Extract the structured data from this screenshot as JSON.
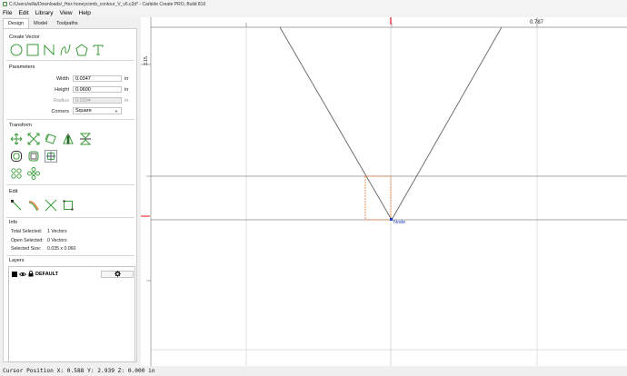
{
  "window": {
    "title": "C:/Users/willa/Downloads/_Hex honeycomb_contour_V_v6.c2d* - Carbide Create PRO, Build 816"
  },
  "menu": [
    "File",
    "Edit",
    "Library",
    "View",
    "Help"
  ],
  "tabs": [
    "Design",
    "Model",
    "Toolpaths"
  ],
  "create_vector": {
    "title": "Create Vector",
    "tools": [
      "circle-icon",
      "rectangle-icon",
      "polyline-icon",
      "curve-icon",
      "polygon-icon",
      "text-icon"
    ]
  },
  "parameters": {
    "title": "Parameters",
    "width": {
      "label": "Width",
      "value": "0.0347",
      "unit": "in"
    },
    "height": {
      "label": "Height",
      "value": "0.0600",
      "unit": "in"
    },
    "radius": {
      "label": "Radius",
      "value": "0.0394",
      "unit": "in"
    },
    "corners": {
      "label": "Corners",
      "value": "Square"
    }
  },
  "transform": {
    "title": "Transform"
  },
  "edit": {
    "title": "Edit"
  },
  "info": {
    "title": "Info",
    "total_selected_label": "Total Selected:",
    "total_selected_value": "1 Vectors",
    "open_selected_label": "Open Selected:",
    "open_selected_value": "0 Vectors",
    "selected_size_label": "Selected Size:",
    "selected_size_value": "0.035 x 0.060"
  },
  "layers": {
    "title": "Layers",
    "default_layer": "DEFAULT"
  },
  "canvas": {
    "ruler_top_value": "0.787",
    "ruler_left_value": "3.15",
    "node_label": "Node",
    "colors": {
      "vector": "#707070",
      "selection": "#e8742a",
      "node": "#1f3fbf",
      "grid": "#d4d4d4",
      "marker": "#e53935"
    }
  },
  "status": {
    "cursor_position": "Cursor Position X: 0.588 Y: 2.939 Z: 0.000 in"
  }
}
